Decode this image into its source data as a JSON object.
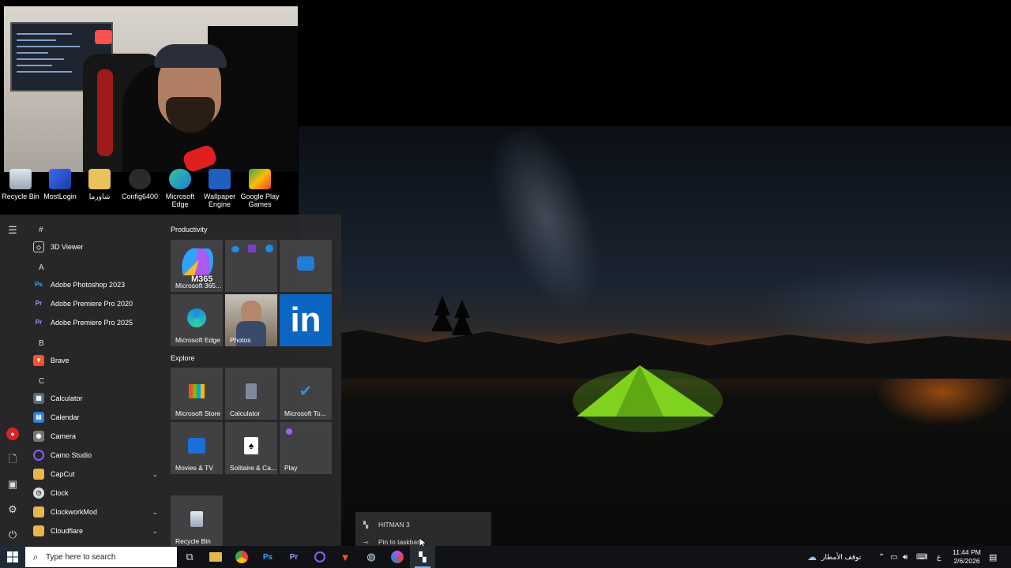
{
  "desktop": {
    "icons": [
      {
        "label": "Recycle Bin",
        "icon": "recycle-bin-icon"
      },
      {
        "label": "MostLogin",
        "icon": "mostlogin-icon"
      },
      {
        "label": "شاورما",
        "icon": "folder-icon"
      },
      {
        "label": "Config6400",
        "icon": "config-icon"
      },
      {
        "label": "Microsoft Edge",
        "icon": "edge-icon"
      },
      {
        "label": "Wallpaper Engine",
        "icon": "wallpaper-engine-icon"
      },
      {
        "label": "Google Play Games",
        "icon": "google-play-games-icon"
      }
    ]
  },
  "start_menu": {
    "app_list": [
      {
        "type": "letter",
        "text": "#"
      },
      {
        "type": "app",
        "label": "3D Viewer"
      },
      {
        "type": "letter",
        "text": "A"
      },
      {
        "type": "app",
        "label": "Adobe Photoshop 2023"
      },
      {
        "type": "app",
        "label": "Adobe Premiere Pro 2020"
      },
      {
        "type": "app",
        "label": "Adobe Premiere Pro 2025"
      },
      {
        "type": "letter",
        "text": "B"
      },
      {
        "type": "app",
        "label": "Brave"
      },
      {
        "type": "letter",
        "text": "C"
      },
      {
        "type": "app",
        "label": "Calculator"
      },
      {
        "type": "app",
        "label": "Calendar"
      },
      {
        "type": "app",
        "label": "Camera"
      },
      {
        "type": "app",
        "label": "Camo Studio"
      },
      {
        "type": "app",
        "label": "CapCut",
        "expandable": true
      },
      {
        "type": "app",
        "label": "Clock"
      },
      {
        "type": "app",
        "label": "ClockworkMod",
        "expandable": true
      },
      {
        "type": "app",
        "label": "Cloudflare",
        "expandable": true
      }
    ],
    "groups": [
      {
        "title": "Productivity"
      },
      {
        "title": "Explore"
      }
    ],
    "tiles": {
      "m365": "Microsoft 365...",
      "m365_badge": "M365",
      "edge": "Microsoft Edge",
      "photos": "Photos",
      "store": "Microsoft Store",
      "calculator": "Calculator",
      "todo": "Microsoft To...",
      "movies": "Movies & TV",
      "solitaire": "Solitaire & Ca...",
      "play": "Play",
      "recycle": "Recycle Bin",
      "linkedin": "in"
    }
  },
  "jump_list": {
    "app_title": "HITMAN 3",
    "pin_label": "Pin to taskbar"
  },
  "taskbar": {
    "search_placeholder": "Type here to search",
    "weather_text": "توقف الأمطار",
    "input_lang": "ع",
    "time": "11:44 PM",
    "date": "2/6/2026"
  },
  "colors": {
    "accent": "#76b9ed",
    "start_bg": "#2a2a2c",
    "taskbar_bg": "#101216",
    "linkedin": "#0a66c2"
  }
}
